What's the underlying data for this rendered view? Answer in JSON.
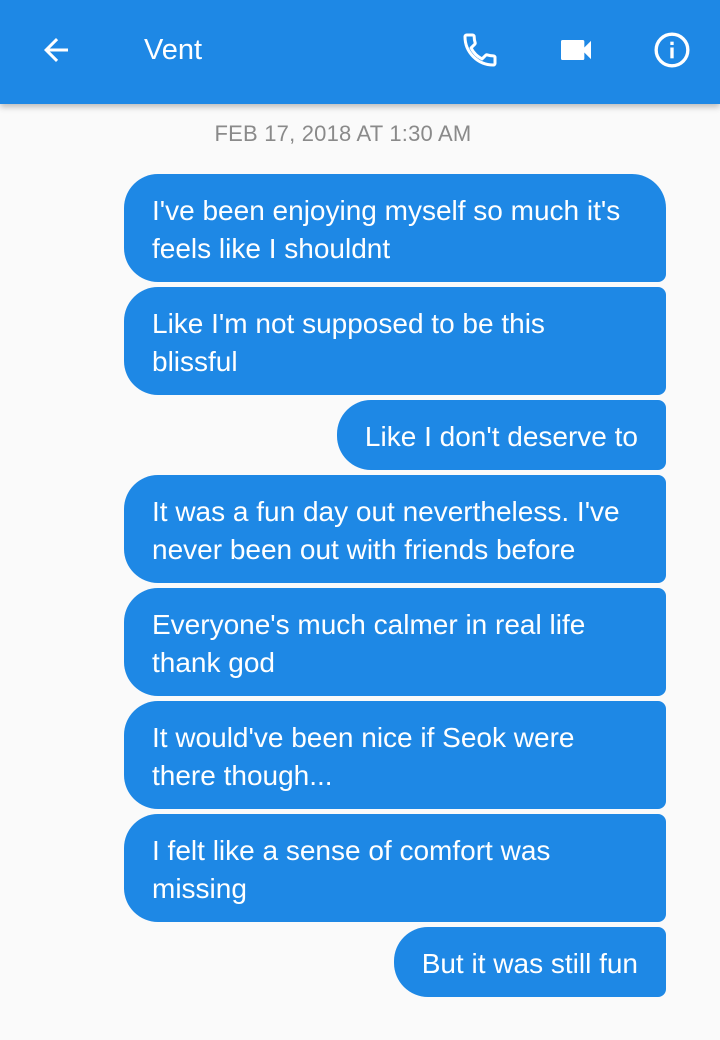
{
  "header": {
    "title": "Vent",
    "back_icon": "arrow-back-icon",
    "call_icon": "phone-icon",
    "video_icon": "video-camera-icon",
    "info_icon": "info-icon"
  },
  "conversation": {
    "timestamp": "FEB 17, 2018 AT 1:30 AM",
    "messages": [
      {
        "text": "I've been enjoying myself so much it's feels like I shouldnt"
      },
      {
        "text": "Like I'm not supposed to be this blissful"
      },
      {
        "text": "Like I don't deserve to"
      },
      {
        "text": "It was a fun day out nevertheless. I've never been out with friends before"
      },
      {
        "text": "Everyone's much calmer in real life thank god"
      },
      {
        "text": "It would've been nice if Seok were there though..."
      },
      {
        "text": "I felt like a sense of comfort was missing"
      },
      {
        "text": "But it was still fun"
      }
    ]
  },
  "colors": {
    "accent": "#1e88e5",
    "background": "#fafafa",
    "timestamp": "#8a8a8a",
    "bubble_text": "#ffffff"
  }
}
